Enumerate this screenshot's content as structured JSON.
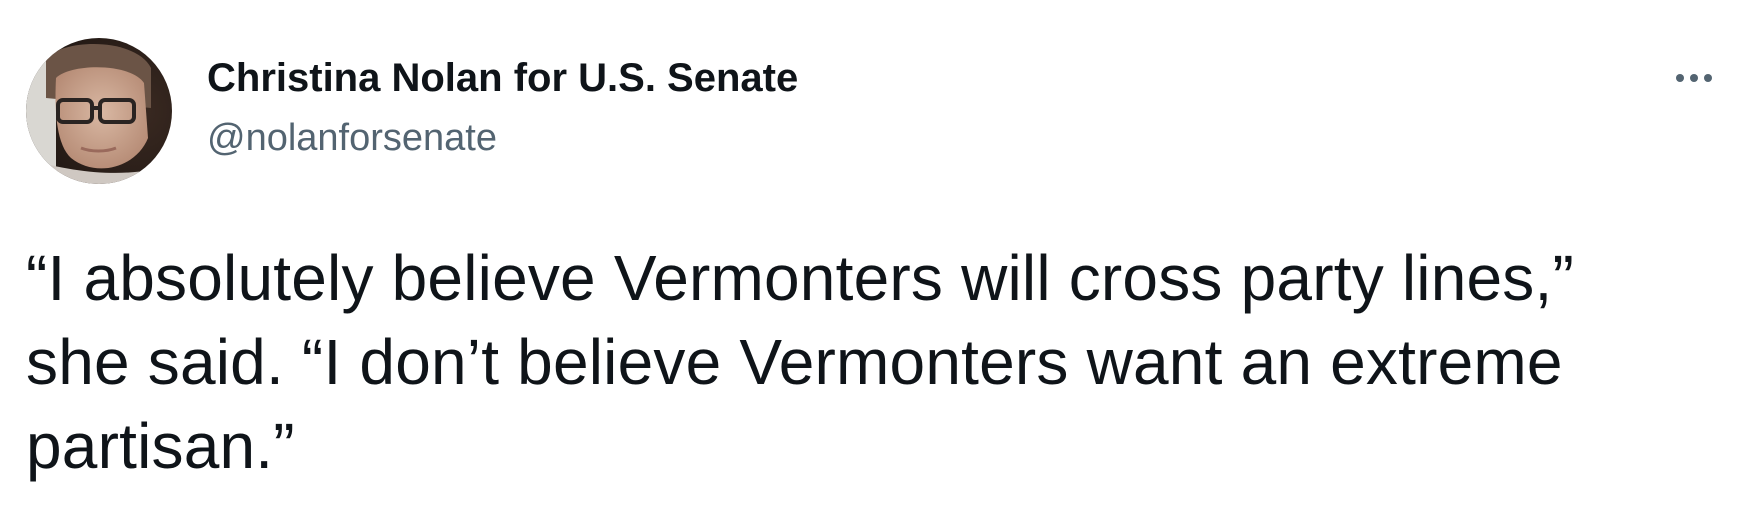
{
  "author": {
    "display_name": "Christina Nolan for U.S. Senate",
    "handle": "@nolanforsenate",
    "avatar": "profile-photo"
  },
  "menu": {
    "icon": "more-horizontal-icon"
  },
  "tweet": {
    "lines": [
      "“I absolutely believe Vermonters will cross party lines,”",
      "she said. “I don’t believe Vermonters want an extreme",
      "partisan.”"
    ]
  },
  "colors": {
    "text_primary": "#0f1419",
    "text_secondary": "#536471",
    "background": "#ffffff"
  }
}
